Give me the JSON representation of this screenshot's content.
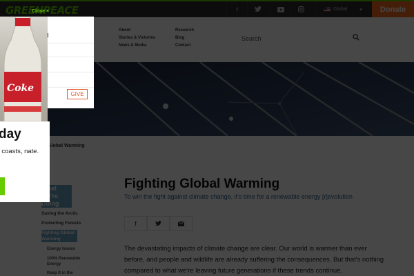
{
  "brand": {
    "logo_text": "GREENPEACE"
  },
  "topbar": {
    "social": [
      "facebook-icon",
      "twitter-icon",
      "youtube-icon",
      "instagram-icon"
    ],
    "language": "Global",
    "donate_label": "Donate"
  },
  "nav": {
    "links_col1": [
      "About",
      "Stories & Victories",
      "News & Media"
    ],
    "links_col2": [
      "Research",
      "Blog",
      "Contact"
    ],
    "search_placeholder": "Search"
  },
  "breadcrumb": [
    "Global Warming"
  ],
  "sidebar": {
    "heading": "What We're Doing",
    "links": [
      "Saving the Arctic",
      "Protecting Forests",
      "Fighting Global Warming"
    ],
    "sub_links": [
      "Energy Issues",
      "100% Renewable Energy",
      "Keep It in the Ground"
    ]
  },
  "article": {
    "title": "Fighting Global Warming",
    "subtitle": "To win the fight against climate change, it's time for a renewable energy [r]evolution",
    "share": [
      "facebook-icon",
      "twitter-icon",
      "email-icon"
    ],
    "body": "The devastating impacts of climate change are clear. Our world is warmer than ever before, and people and wildlife are already suffering the consequences. But that's nothing compared to what we're leaving future generations if these trends continue."
  },
  "popup": {
    "close_label": "Close ×",
    "card_title": "ing",
    "give_label": "GIVE",
    "heading": "day",
    "text": "our coasts, nate.",
    "bottle_label": "Coke"
  },
  "colors": {
    "brand_green": "#66cc00",
    "donate_orange": "#f36d21",
    "highlight_blue": "#6aa0bd",
    "topbar": "#2c2c2c"
  }
}
